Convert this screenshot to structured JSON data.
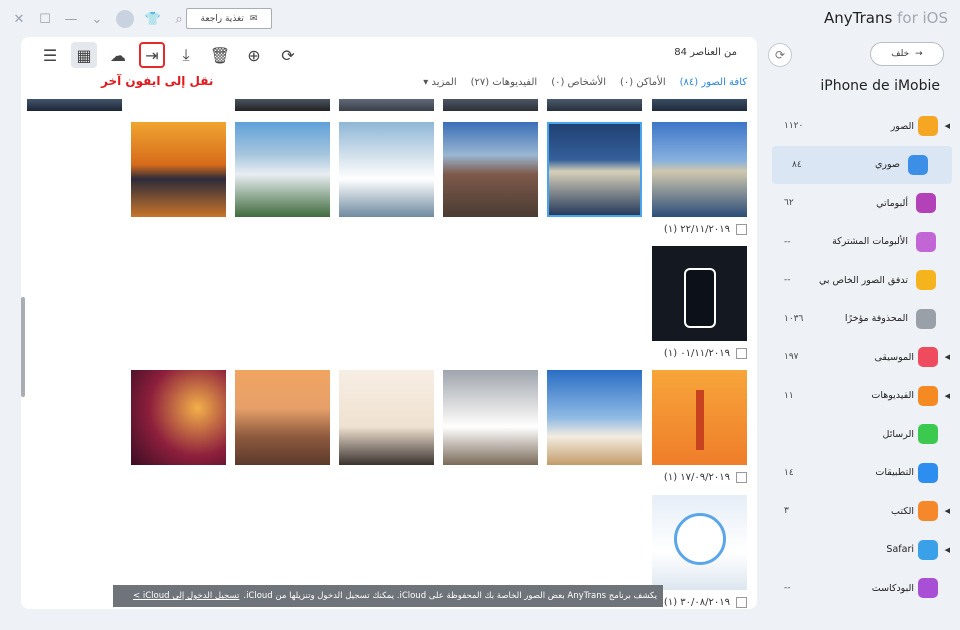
{
  "app": {
    "brand": "AnyTrans",
    "brand_sub": "for iOS",
    "feedback": "تغذية راجعة"
  },
  "toolbar": {
    "count_text": "84 من العناصر",
    "transfer_tip": "نقل إلى ايفون آخر"
  },
  "filters": [
    "كافة الصور (٨٤)",
    "الأماكن (٠)",
    "الأشخاص (٠)",
    "الفيديوهات (٢٧)",
    "المزيد ▾"
  ],
  "groups": [
    {
      "date": "(١) ٢٢/١١/٢٠١٩"
    },
    {
      "date": "(١) ٠١/١١/٢٠١٩"
    },
    {
      "date": "(١) ١٧/٠٩/٢٠١٩"
    },
    {
      "date": "(١) ٣٠/٠٨/٢٠١٩"
    }
  ],
  "banner": {
    "text": "يكشف برنامج AnyTrans بعض الصور الخاصة بك المحفوظة على iCloud. يمكنك تسجيل الدخول وتنزيلها من iCloud.",
    "link": "تسجيل الدخول إلى iCloud >"
  },
  "side": {
    "back_label": "خلف",
    "device_name": "iPhone de iMobie",
    "items": [
      {
        "label": "الصور",
        "count": "١١٢٠",
        "arrow": true,
        "icon": "photos-icon",
        "color": "#f5a623"
      },
      {
        "label": "صوري",
        "count": "٨٤",
        "sub": true,
        "active": true,
        "icon": "my-photos-icon",
        "color": "#3b8fe6"
      },
      {
        "label": "ألبوماتي",
        "count": "٦٢",
        "sub": true,
        "icon": "album-icon",
        "color": "#b342b8"
      },
      {
        "label": "الألبومات المشتركة",
        "count": "--",
        "sub": true,
        "icon": "shared-icon",
        "color": "#c266d6"
      },
      {
        "label": "تدفق الصور الخاص بي",
        "count": "--",
        "sub": true,
        "icon": "sunflower-icon",
        "color": "#f5b31e"
      },
      {
        "label": "المحذوفة مؤخرًا",
        "count": "١٠٣٦",
        "sub": true,
        "icon": "trash-icon",
        "color": "#9aa0a8"
      },
      {
        "label": "الموسيقى",
        "count": "١٩٧",
        "arrow": true,
        "icon": "music-icon",
        "color": "#ef4b5f"
      },
      {
        "label": "الفيديوهات",
        "count": "١١",
        "arrow": true,
        "icon": "video-icon",
        "color": "#f58a23"
      },
      {
        "label": "الرسائل",
        "count": "",
        "icon": "message-icon",
        "color": "#3cc94f"
      },
      {
        "label": "التطبيقات",
        "count": "١٤",
        "icon": "appstore-icon",
        "color": "#2d8ef0"
      },
      {
        "label": "الكتب",
        "count": "٣",
        "arrow": true,
        "icon": "books-icon",
        "color": "#f5882a"
      },
      {
        "label": "Safari",
        "count": "",
        "arrow": true,
        "icon": "safari-icon",
        "color": "#3aa0e8"
      },
      {
        "label": "البودكاست",
        "count": "--",
        "icon": "podcast-icon",
        "color": "#a84fd6"
      }
    ]
  }
}
